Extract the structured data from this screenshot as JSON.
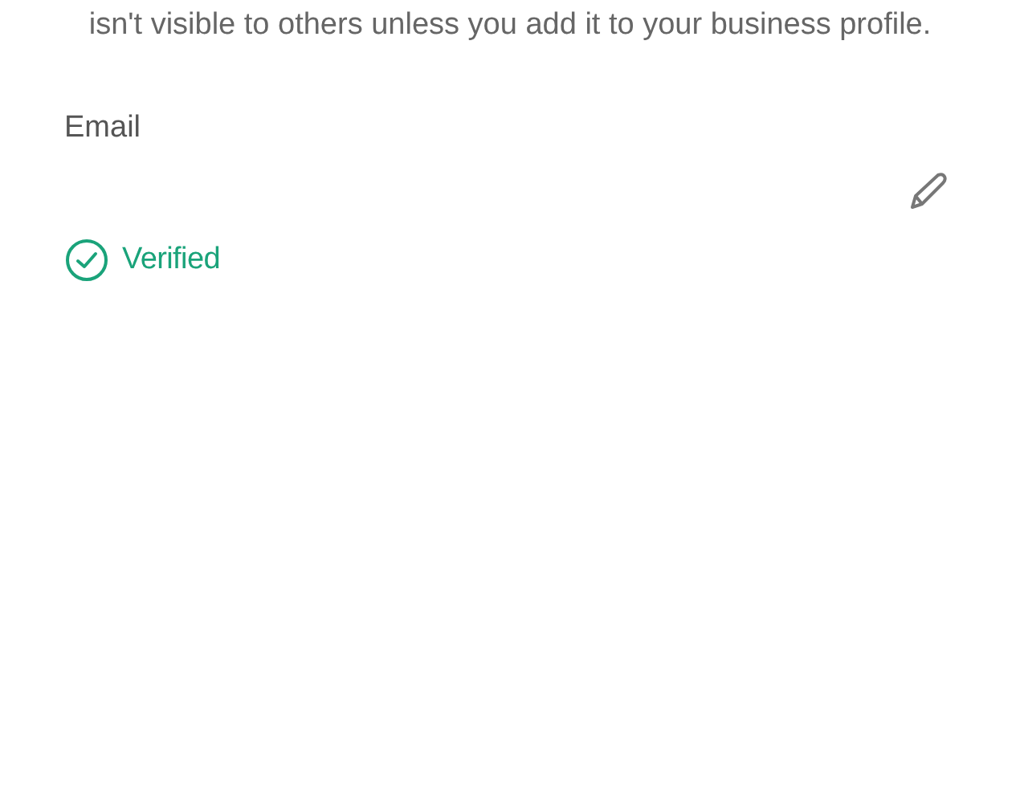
{
  "notice": "isn't visible to others unless you add it to your business profile.",
  "email": {
    "label": "Email",
    "verified": true,
    "status": "Verified"
  }
}
